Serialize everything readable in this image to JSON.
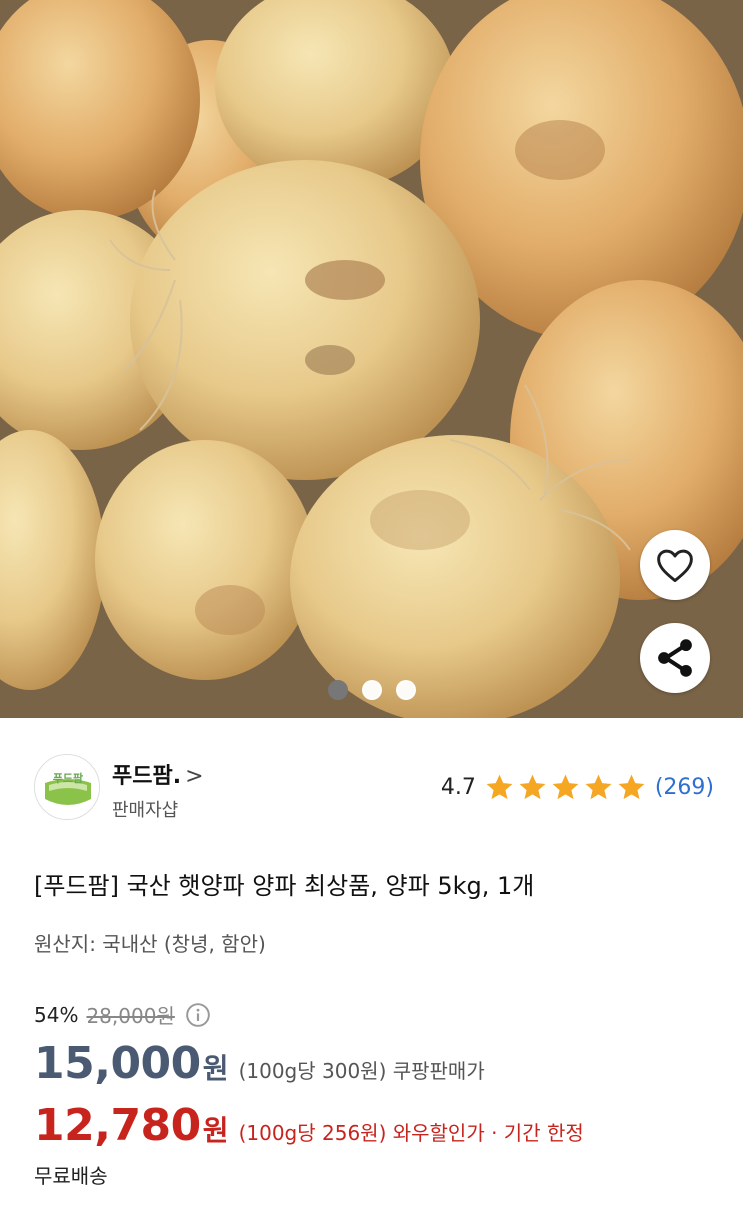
{
  "seller": {
    "logo_text": "푸드팜",
    "name": "푸드팜.",
    "chevron": ">",
    "subtitle": "판매자샵"
  },
  "rating": {
    "score": "4.7",
    "stars_filled": 5,
    "count": "(269)",
    "star_color": "#f5a623"
  },
  "product": {
    "title": "[푸드팜] 국산 햇양파 양파 최상품, 양파 5kg, 1개",
    "origin": "원산지: 국내산 (창녕, 함안)"
  },
  "pricing": {
    "discount_percent": "54%",
    "original_price": "28,000원",
    "coupang": {
      "amount": "15,000",
      "unit": "원",
      "detail": "(100g당 300원) 쿠팡판매가",
      "color": "#4a5a72"
    },
    "wow": {
      "amount": "12,780",
      "unit": "원",
      "detail": "(100g당 256원) 와우할인가 · 기간 한정",
      "color": "#c8241e"
    }
  },
  "shipping": "무료배송",
  "gallery": {
    "current_index": 1,
    "total": 3
  },
  "icons": {
    "favorite": "heart-icon",
    "share": "share-icon",
    "info": "info-icon"
  }
}
